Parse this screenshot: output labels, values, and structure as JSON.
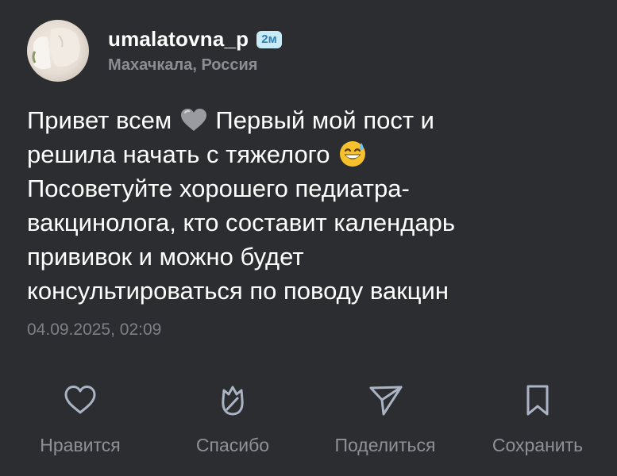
{
  "post": {
    "author": {
      "username": "umalatovna_p",
      "location": "Махачкала, Россия",
      "time_badge": "2м"
    },
    "text": {
      "line1_a": "Привет всем",
      "line1_b": "Первый мой пост и",
      "line2": "решила начать с тяжелого",
      "line3": "Посоветуйте хорошего педиатра-",
      "line4": "вакцинолога, кто составит календарь",
      "line5": "прививок и можно будет",
      "line6": "консультироваться по поводу вакцин"
    },
    "date": "04.09.2025, 02:09"
  },
  "actions": {
    "like_label": "Нравится",
    "thanks_label": "Спасибо",
    "share_label": "Поделиться",
    "save_label": "Сохранить"
  },
  "icons": {
    "like": "heart-icon",
    "thanks": "tulip-icon",
    "share": "send-icon",
    "save": "bookmark-icon",
    "emoji1": "grey-heart-emoji",
    "emoji2": "grinning-sweat-emoji"
  },
  "colors": {
    "background": "#2c2d30",
    "text_primary": "#ffffff",
    "text_secondary": "#8a8d93",
    "badge_bg": "#c9eaf7",
    "badge_text": "#2f7fb0",
    "icon_stroke": "#aab4c4"
  }
}
